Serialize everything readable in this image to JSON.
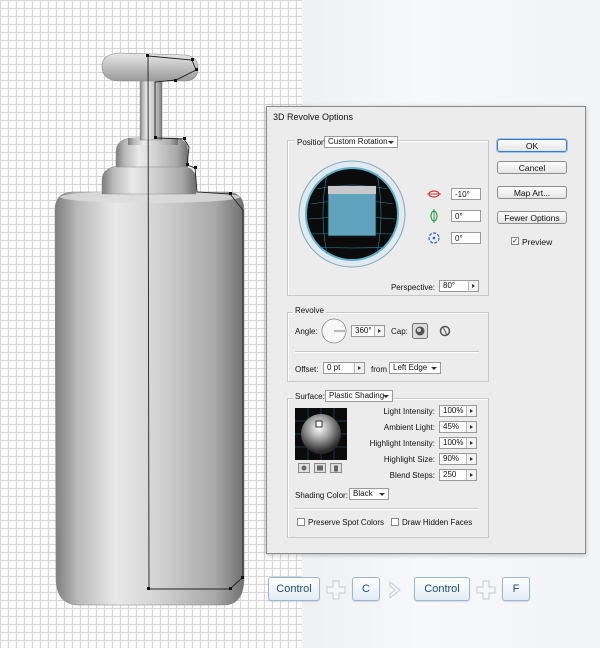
{
  "dialog": {
    "title": "3D Revolve Options",
    "position_label": "Position:",
    "position_value": "Custom Rotation",
    "rot_x": "-10°",
    "rot_y": "0°",
    "rot_z": "0°",
    "perspective_label": "Perspective:",
    "perspective_value": "80°",
    "revolve_legend": "Revolve",
    "angle_label": "Angle:",
    "angle_value": "360°",
    "cap_label": "Cap:",
    "offset_label": "Offset:",
    "offset_value": "0 pt",
    "from_label": "from",
    "from_value": "Left Edge",
    "surface_label": "Surface:",
    "surface_value": "Plastic Shading",
    "light_intensity_label": "Light Intensity:",
    "light_intensity_value": "100%",
    "ambient_light_label": "Ambient Light:",
    "ambient_light_value": "45%",
    "highlight_intensity_label": "Highlight Intensity:",
    "highlight_intensity_value": "100%",
    "highlight_size_label": "Highlight Size:",
    "highlight_size_value": "90%",
    "blend_steps_label": "Blend Steps:",
    "blend_steps_value": "250",
    "shading_color_label": "Shading Color:",
    "shading_color_value": "Black",
    "preserve_spot_label": "Preserve Spot Colors",
    "draw_hidden_label": "Draw Hidden Faces",
    "buttons": {
      "ok": "OK",
      "cancel": "Cancel",
      "map_art": "Map Art...",
      "fewer_options": "Fewer Options"
    },
    "preview_label": "Preview",
    "preview_checked": true
  },
  "shortcuts": {
    "key1": "Control",
    "key2": "C",
    "key3": "Control",
    "key4": "F"
  },
  "colors": {
    "accent": "#3a7bc7",
    "cube_face": "#5fa3bd",
    "sphere_bg": "#0b0b0b"
  }
}
